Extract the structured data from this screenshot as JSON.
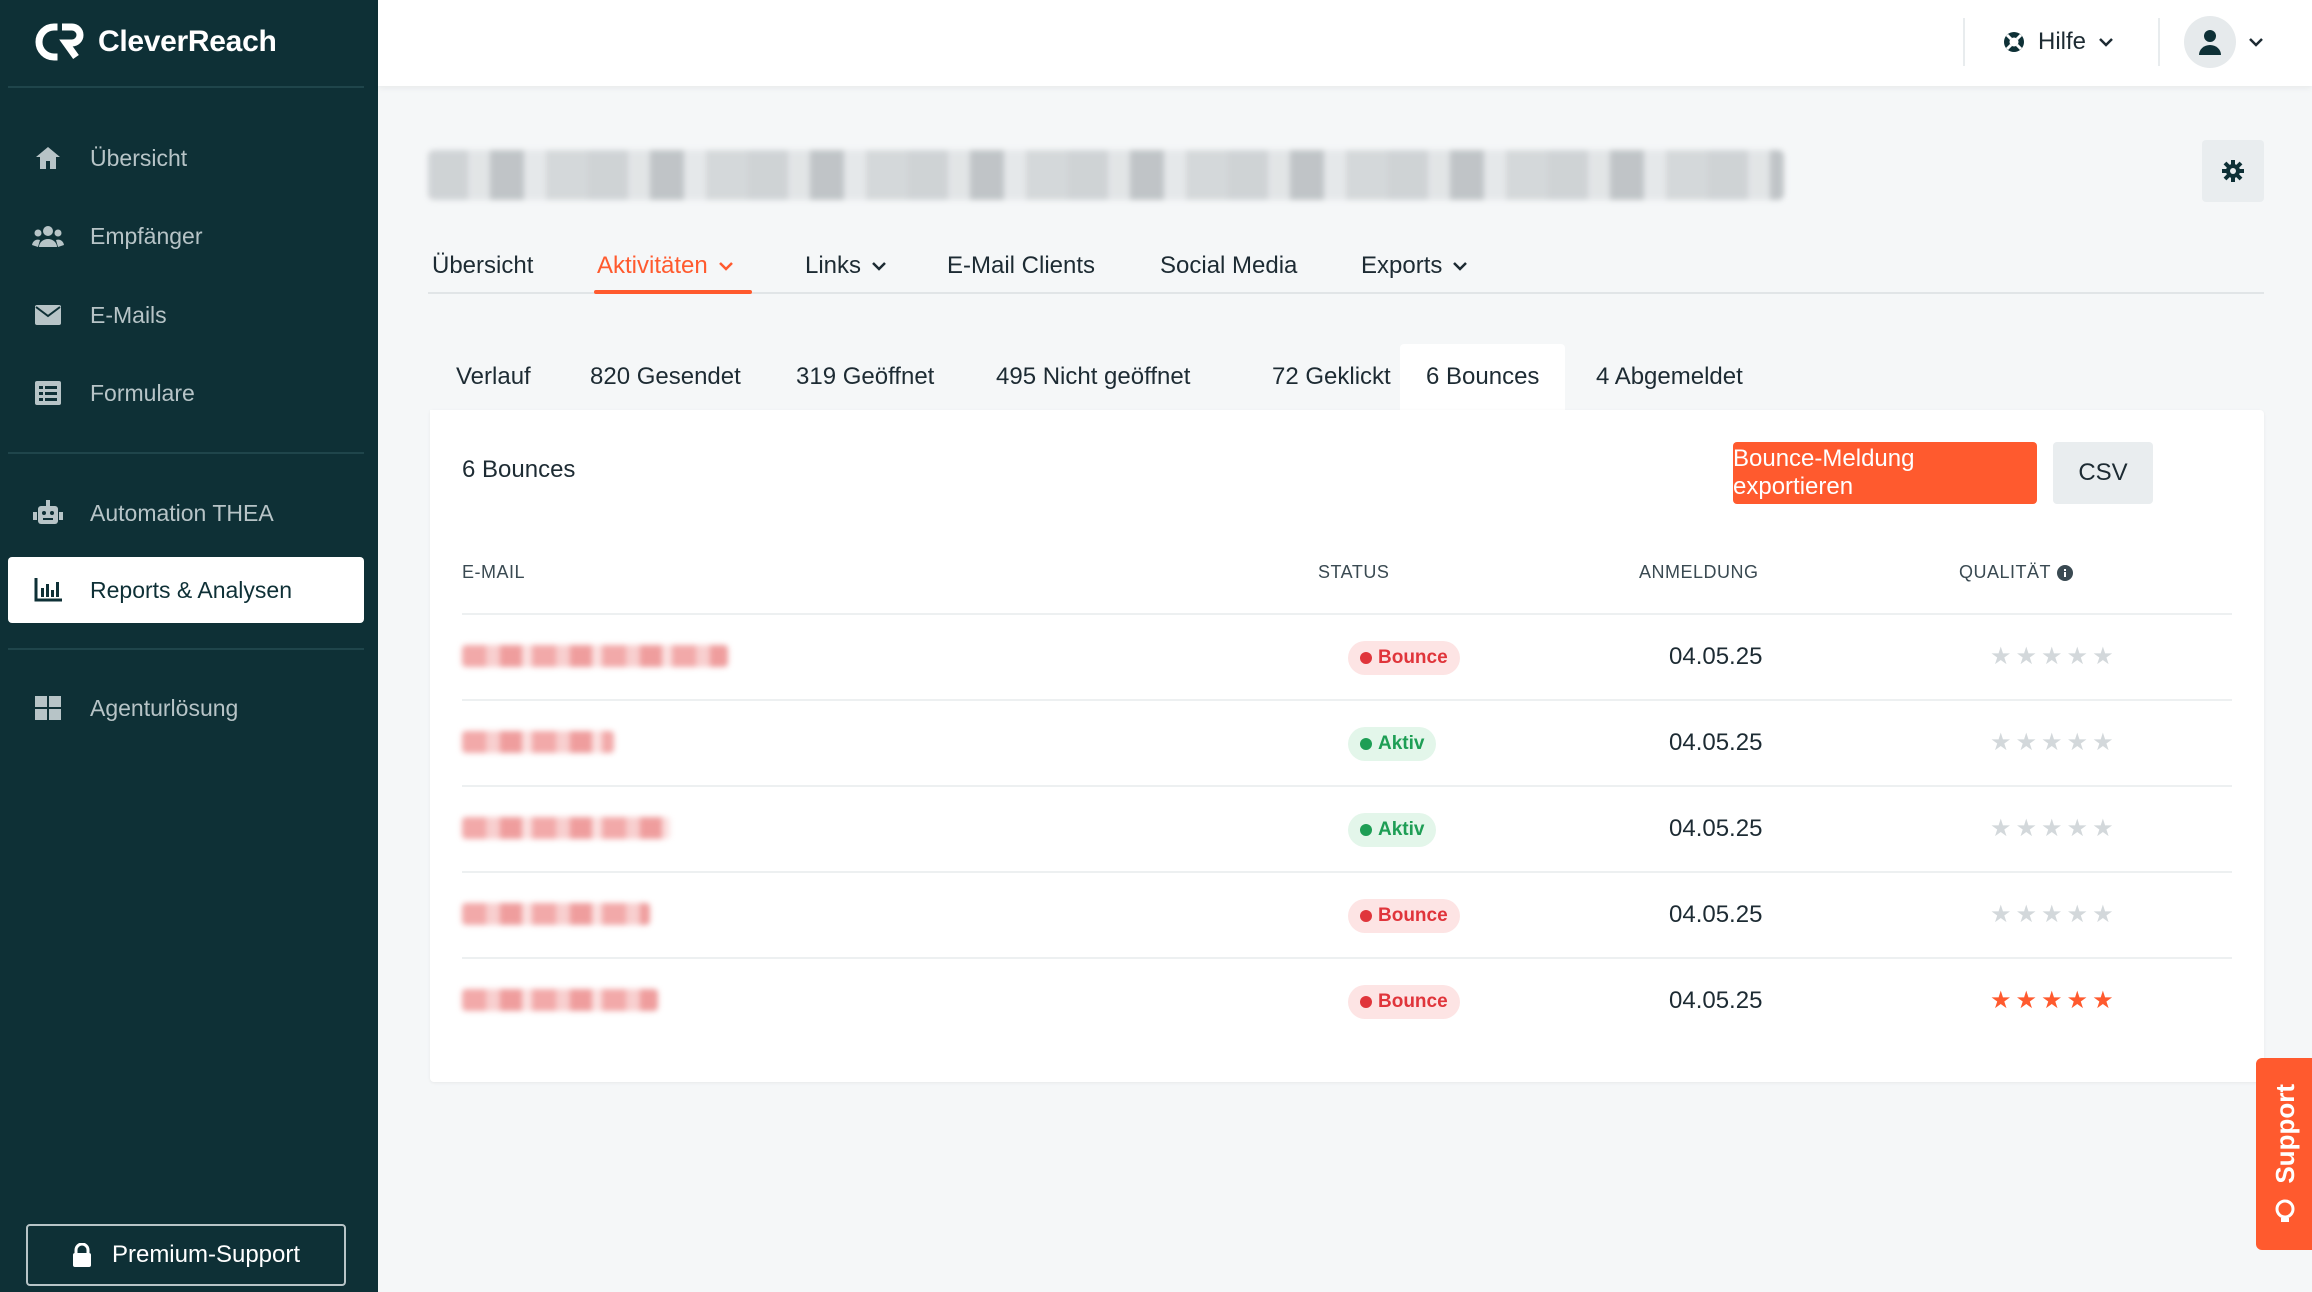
{
  "app": {
    "logo_text": "CleverReach"
  },
  "sidebar": {
    "items": [
      {
        "label": "Übersicht",
        "icon": "home-icon"
      },
      {
        "label": "Empfänger",
        "icon": "users-icon"
      },
      {
        "label": "E-Mails",
        "icon": "envelope-icon"
      },
      {
        "label": "Formulare",
        "icon": "form-icon"
      },
      {
        "label": "Automation THEA",
        "icon": "robot-icon"
      },
      {
        "label": "Reports & Analysen",
        "icon": "chart-icon",
        "active": true
      },
      {
        "label": "Agenturlösung",
        "icon": "grid-icon"
      }
    ],
    "premium_label": "Premium-Support"
  },
  "topbar": {
    "help_label": "Hilfe"
  },
  "main_tabs": [
    {
      "label": "Übersicht"
    },
    {
      "label": "Aktivitäten",
      "active": true
    },
    {
      "label": "Links"
    },
    {
      "label": "E-Mail Clients"
    },
    {
      "label": "Social Media"
    },
    {
      "label": "Exports"
    }
  ],
  "sub_tabs": [
    {
      "label": "Verlauf"
    },
    {
      "label": "820 Gesendet"
    },
    {
      "label": "319 Geöffnet"
    },
    {
      "label": "495 Nicht geöffnet"
    },
    {
      "label": "72 Geklickt"
    },
    {
      "label": "6 Bounces",
      "active": true
    },
    {
      "label": "4 Abgemeldet"
    }
  ],
  "card": {
    "title": "6 Bounces",
    "export_label": "Bounce-Meldung exportieren",
    "csv_label": "CSV"
  },
  "table": {
    "headers": {
      "email": "E-MAIL",
      "status": "STATUS",
      "signup": "ANMELDUNG",
      "quality": "QUALITÄT"
    },
    "rows": [
      {
        "status": "Bounce",
        "date": "04.05.25",
        "stars": 0
      },
      {
        "status": "Aktiv",
        "date": "04.05.25",
        "stars": 0
      },
      {
        "status": "Aktiv",
        "date": "04.05.25",
        "stars": 0
      },
      {
        "status": "Bounce",
        "date": "04.05.25",
        "stars": 0
      },
      {
        "status": "Bounce",
        "date": "04.05.25",
        "stars": 5
      }
    ]
  },
  "support_tab": {
    "label": "Support"
  },
  "colors": {
    "accent": "#ff5a2e",
    "sidebar": "#0e3036",
    "bounce": "#e0353b",
    "aktiv": "#1e9e55",
    "star_off": "#d3d8db"
  }
}
